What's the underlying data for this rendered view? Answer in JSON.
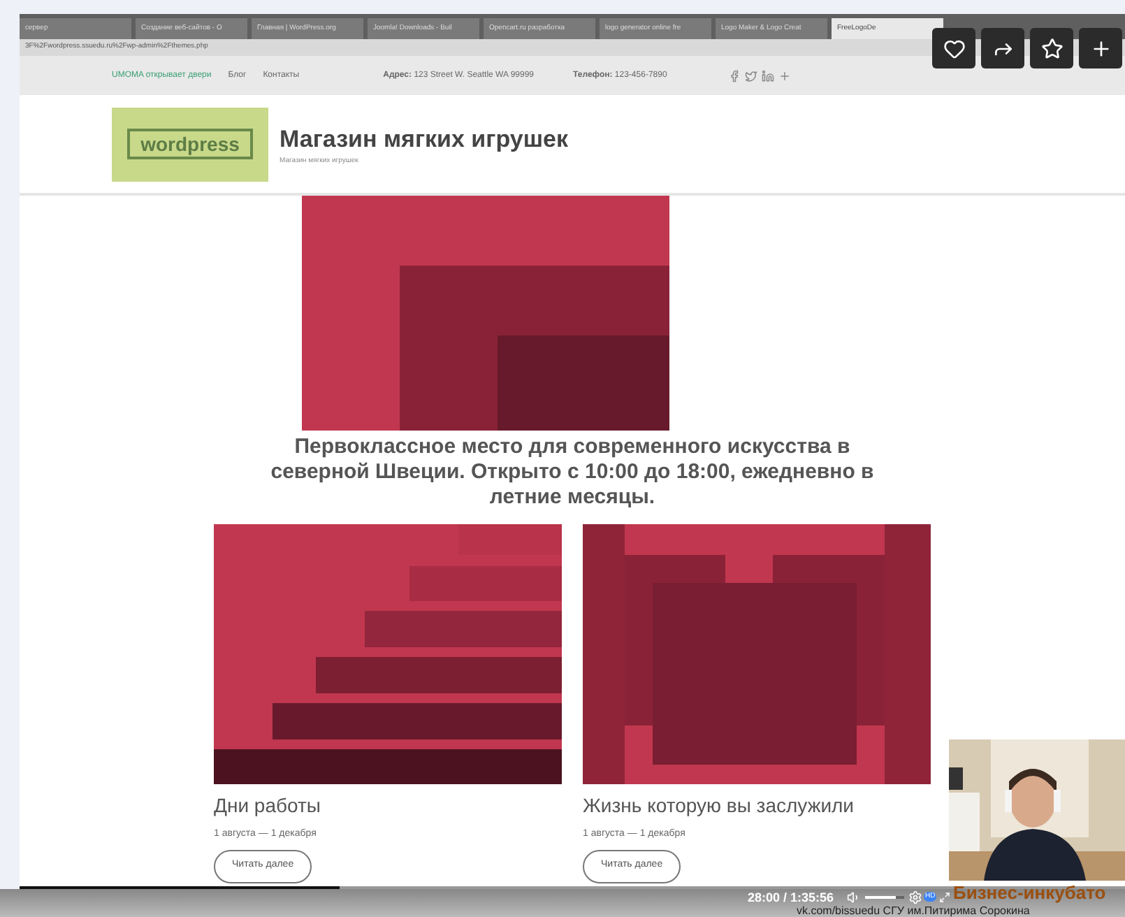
{
  "browser": {
    "tabs": [
      {
        "title": "сервер",
        "selected": false
      },
      {
        "title": "Создание веб-сайтов - О",
        "selected": false
      },
      {
        "title": "Главная | WordPress.org",
        "selected": false
      },
      {
        "title": "Joomla! Downloads - Buil",
        "selected": false
      },
      {
        "title": "Opencart.ru разработка",
        "selected": false
      },
      {
        "title": "logo generator online fre",
        "selected": false
      },
      {
        "title": "Logo Maker & Logo Creat",
        "selected": false
      },
      {
        "title": "FreeLogoDe",
        "selected": true
      }
    ],
    "url": "3F%2Fwordpress.ssuedu.ru%2Fwp-admin%2Fthemes.php"
  },
  "site": {
    "topbar": {
      "links": [
        "UMOMA открывает двери",
        "Блог",
        "Контакты"
      ],
      "address_label": "Адрес:",
      "address": "123 Street W. Seattle WA 99999",
      "phone_label": "Телефон:",
      "phone": "123-456-7890"
    },
    "logo": "wordpress",
    "title": "Магазин мягких игрушек",
    "tagline": "Магазин мягких игрушек",
    "hero_heading": "Первоклассное место для современного искусства в северной Швеции. Открыто с 10:00 до 18:00, ежедневно в летние месяцы.",
    "cards": [
      {
        "kind": "steps",
        "title": "Дни работы",
        "date": "1 августа — 1 декабря",
        "button": "Читать далее"
      },
      {
        "kind": "blocks",
        "title": "Жизнь которую вы заслужили",
        "date": "1 августа — 1 декабря",
        "button": "Читать далее"
      }
    ]
  },
  "player": {
    "time": "28:00 / 1:35:56",
    "seek": {
      "level": 0.29
    },
    "volume": {
      "level": 0.8
    },
    "quality": "HD",
    "banner": "Бизнес-инкубато",
    "footer": "vk.com/bissuedu  СГУ им.Питирима Сорокина"
  }
}
